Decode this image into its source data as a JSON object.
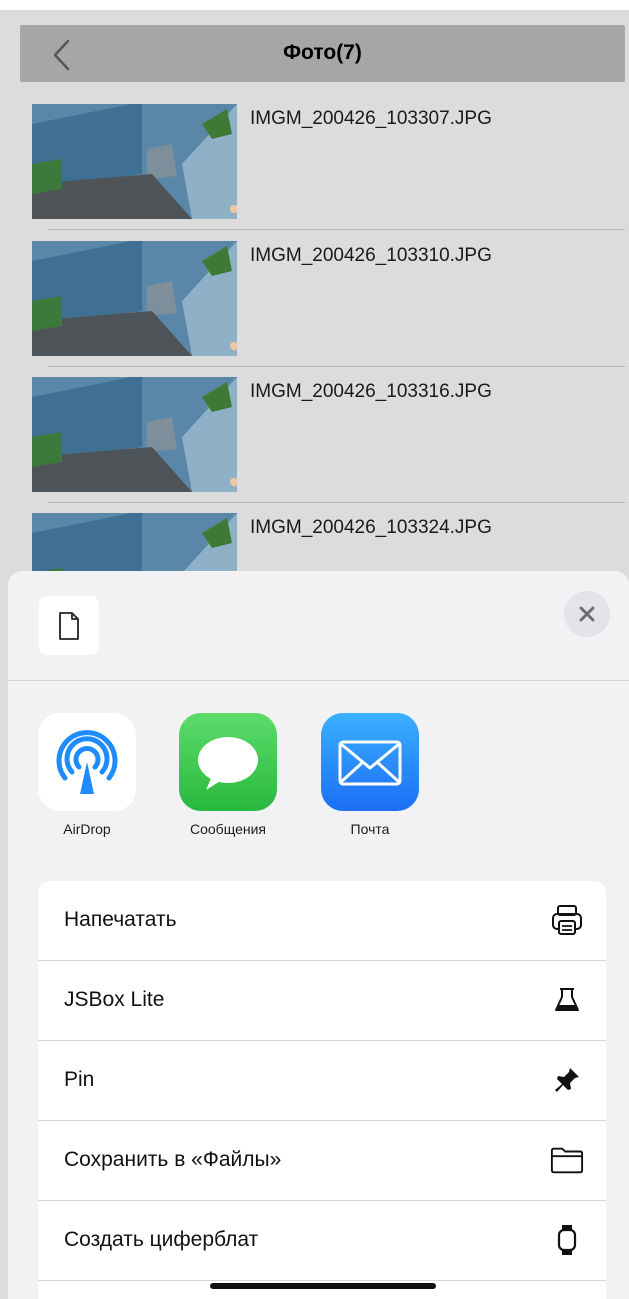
{
  "navbar": {
    "title": "Фото(7)",
    "back_icon": "chevron-left-icon"
  },
  "photos": [
    {
      "name": "IMGM_200426_103307.JPG"
    },
    {
      "name": "IMGM_200426_103310.JPG"
    },
    {
      "name": "IMGM_200426_103316.JPG"
    },
    {
      "name": "IMGM_200426_103324.JPG"
    }
  ],
  "share_sheet": {
    "file_icon": "document-icon",
    "close_icon": "close-icon",
    "apps": [
      {
        "label": "AirDrop",
        "icon": "airdrop-icon",
        "color": "#1e8bff"
      },
      {
        "label": "Сообщения",
        "icon": "messages-icon",
        "color": "#34c759"
      },
      {
        "label": "Почта",
        "icon": "mail-icon",
        "color": "#1a8cff"
      }
    ],
    "actions": [
      {
        "label": "Напечатать",
        "icon": "printer-icon"
      },
      {
        "label": "JSBox Lite",
        "icon": "flask-icon"
      },
      {
        "label": "Pin",
        "icon": "pin-icon"
      },
      {
        "label": "Сохранить в «Файлы»",
        "icon": "folder-icon"
      },
      {
        "label": "Создать циферблат",
        "icon": "watch-icon"
      },
      {
        "label": "",
        "icon": "more-icon"
      }
    ]
  }
}
